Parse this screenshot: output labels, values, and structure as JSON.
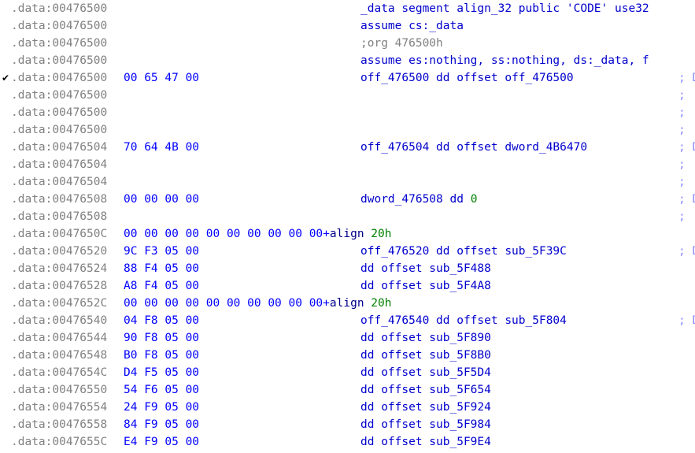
{
  "app": {
    "name": "ida-disassembly-view",
    "segment": ".data",
    "colors": {
      "background": "#ffffff",
      "address": "#808080",
      "hex_bytes": "#0000ff",
      "instruction": "#0000cd",
      "keyword": "#00008b",
      "number": "#008000",
      "comment": "#808080",
      "xref_comment": "#8a8aff"
    }
  },
  "lines": [
    {
      "marker": "",
      "address": ".data:00476500",
      "bytes": "",
      "bytes_suffix_kw": "",
      "bytes_suffix_num": "",
      "text": "_data segment align_32 public 'CODE' use32",
      "text_kind": "code",
      "comment": ""
    },
    {
      "marker": "",
      "address": ".data:00476500",
      "bytes": "",
      "bytes_suffix_kw": "",
      "bytes_suffix_num": "",
      "text": "assume cs:_data",
      "text_kind": "code",
      "comment": ""
    },
    {
      "marker": "",
      "address": ".data:00476500",
      "bytes": "",
      "bytes_suffix_kw": "",
      "bytes_suffix_num": "",
      "text": ";org 476500h",
      "text_kind": "comment",
      "comment": ""
    },
    {
      "marker": "",
      "address": ".data:00476500",
      "bytes": "",
      "bytes_suffix_kw": "",
      "bytes_suffix_num": "",
      "text": "assume es:nothing, ss:nothing, ds:_data, f",
      "text_kind": "code",
      "comment": ""
    },
    {
      "marker": "✔",
      "address": ".data:00476500",
      "bytes": "00 65 47 00",
      "bytes_suffix_kw": "",
      "bytes_suffix_num": "",
      "text": "off_476500 dd offset off_476500",
      "text_kind": "code",
      "comment": "; D"
    },
    {
      "marker": "",
      "address": ".data:00476500",
      "bytes": "",
      "bytes_suffix_kw": "",
      "bytes_suffix_num": "",
      "text": "",
      "text_kind": "code",
      "comment": ";"
    },
    {
      "marker": "",
      "address": ".data:00476500",
      "bytes": "",
      "bytes_suffix_kw": "",
      "bytes_suffix_num": "",
      "text": "",
      "text_kind": "code",
      "comment": ";"
    },
    {
      "marker": "",
      "address": ".data:00476500",
      "bytes": "",
      "bytes_suffix_kw": "",
      "bytes_suffix_num": "",
      "text": "",
      "text_kind": "code",
      "comment": ";"
    },
    {
      "marker": "",
      "address": ".data:00476504",
      "bytes": "70 64 4B 00",
      "bytes_suffix_kw": "",
      "bytes_suffix_num": "",
      "text": "off_476504 dd offset dword_4B6470",
      "text_kind": "code",
      "comment": "; D"
    },
    {
      "marker": "",
      "address": ".data:00476504",
      "bytes": "",
      "bytes_suffix_kw": "",
      "bytes_suffix_num": "",
      "text": "",
      "text_kind": "code",
      "comment": ";"
    },
    {
      "marker": "",
      "address": ".data:00476504",
      "bytes": "",
      "bytes_suffix_kw": "",
      "bytes_suffix_num": "",
      "text": "",
      "text_kind": "code",
      "comment": ";"
    },
    {
      "marker": "",
      "address": ".data:00476508",
      "bytes": "00 00 00 00",
      "bytes_suffix_kw": "",
      "bytes_suffix_num": "",
      "text": "dword_476508 dd 0",
      "text_kind": "code-num-tail",
      "comment": "; D"
    },
    {
      "marker": "",
      "address": ".data:00476508",
      "bytes": "",
      "bytes_suffix_kw": "",
      "bytes_suffix_num": "",
      "text": "",
      "text_kind": "code",
      "comment": ";"
    },
    {
      "marker": "",
      "address": ".data:0047650C",
      "bytes": "00 00 00 00 00 00 00 00 00 00+",
      "bytes_suffix_kw": "align",
      "bytes_suffix_num": "20h",
      "text": "",
      "text_kind": "code",
      "comment": ""
    },
    {
      "marker": "",
      "address": ".data:00476520",
      "bytes": "9C F3 05 00",
      "bytes_suffix_kw": "",
      "bytes_suffix_num": "",
      "text": "off_476520 dd offset sub_5F39C",
      "text_kind": "code",
      "comment": "; D"
    },
    {
      "marker": "",
      "address": ".data:00476524",
      "bytes": "88 F4 05 00",
      "bytes_suffix_kw": "",
      "bytes_suffix_num": "",
      "text": "dd offset sub_5F488",
      "text_kind": "code",
      "comment": ""
    },
    {
      "marker": "",
      "address": ".data:00476528",
      "bytes": "A8 F4 05 00",
      "bytes_suffix_kw": "",
      "bytes_suffix_num": "",
      "text": "dd offset sub_5F4A8",
      "text_kind": "code",
      "comment": ""
    },
    {
      "marker": "",
      "address": ".data:0047652C",
      "bytes": "00 00 00 00 00 00 00 00 00 00+",
      "bytes_suffix_kw": "align",
      "bytes_suffix_num": "20h",
      "text": "",
      "text_kind": "code",
      "comment": ""
    },
    {
      "marker": "",
      "address": ".data:00476540",
      "bytes": "04 F8 05 00",
      "bytes_suffix_kw": "",
      "bytes_suffix_num": "",
      "text": "off_476540 dd offset sub_5F804",
      "text_kind": "code",
      "comment": "; D"
    },
    {
      "marker": "",
      "address": ".data:00476544",
      "bytes": "90 F8 05 00",
      "bytes_suffix_kw": "",
      "bytes_suffix_num": "",
      "text": "dd offset sub_5F890",
      "text_kind": "code",
      "comment": ""
    },
    {
      "marker": "",
      "address": ".data:00476548",
      "bytes": "B0 F8 05 00",
      "bytes_suffix_kw": "",
      "bytes_suffix_num": "",
      "text": "dd offset sub_5F8B0",
      "text_kind": "code",
      "comment": ""
    },
    {
      "marker": "",
      "address": ".data:0047654C",
      "bytes": "D4 F5 05 00",
      "bytes_suffix_kw": "",
      "bytes_suffix_num": "",
      "text": "dd offset sub_5F5D4",
      "text_kind": "code",
      "comment": ""
    },
    {
      "marker": "",
      "address": ".data:00476550",
      "bytes": "54 F6 05 00",
      "bytes_suffix_kw": "",
      "bytes_suffix_num": "",
      "text": "dd offset sub_5F654",
      "text_kind": "code",
      "comment": ""
    },
    {
      "marker": "",
      "address": ".data:00476554",
      "bytes": "24 F9 05 00",
      "bytes_suffix_kw": "",
      "bytes_suffix_num": "",
      "text": "dd offset sub_5F924",
      "text_kind": "code",
      "comment": ""
    },
    {
      "marker": "",
      "address": ".data:00476558",
      "bytes": "84 F9 05 00",
      "bytes_suffix_kw": "",
      "bytes_suffix_num": "",
      "text": "dd offset sub_5F984",
      "text_kind": "code",
      "comment": ""
    },
    {
      "marker": "",
      "address": ".data:0047655C",
      "bytes": "E4 F9 05 00",
      "bytes_suffix_kw": "",
      "bytes_suffix_num": "",
      "text": "dd offset sub_5F9E4",
      "text_kind": "code",
      "comment": ""
    }
  ]
}
